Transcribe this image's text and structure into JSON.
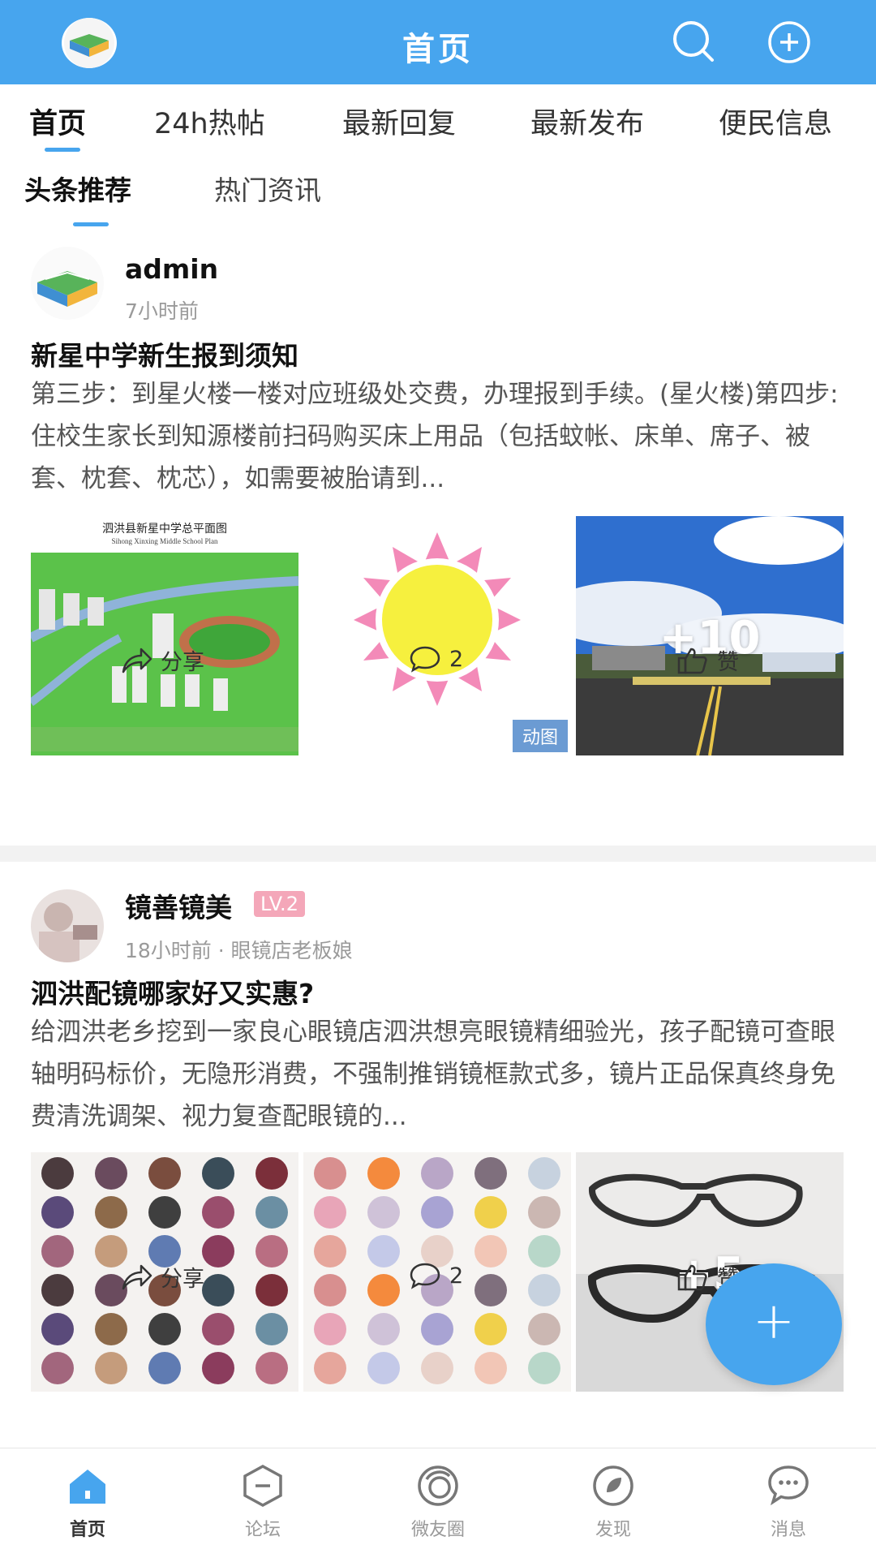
{
  "header": {
    "title": "首页"
  },
  "tabs": [
    {
      "label": "首页",
      "active": true
    },
    {
      "label": "24h热帖"
    },
    {
      "label": "最新回复"
    },
    {
      "label": "最新发布"
    },
    {
      "label": "便民信息"
    }
  ],
  "subtabs": [
    {
      "label": "头条推荐",
      "active": true
    },
    {
      "label": "热门资讯"
    }
  ],
  "posts": [
    {
      "username": "admin",
      "time": "7小时前",
      "title": "新星中学新生报到须知",
      "excerpt": "第三步：到星火楼一楼对应班级处交费，办理报到手续。(星火楼)第四步:住校生家长到知源楼前扫码购买床上用品（包括蚊帐、床单、席子、被套、枕套、枕芯），如需要被胎请到...",
      "images": [
        {
          "caption": "泗洪县新星中学总平面图",
          "caption_en": "Sihong Xinxing Middle School Plan"
        },
        {
          "badge": "动图"
        },
        {
          "more": "+10"
        }
      ],
      "share_label": "分享",
      "comment_count": "2",
      "like_label": "赞"
    },
    {
      "username": "镜善镜美",
      "level": "LV.2",
      "time": "18小时前 · 眼镜店老板娘",
      "title": "泗洪配镜哪家好又实惠?",
      "excerpt": "给泗洪老乡挖到一家良心眼镜店泗洪想亮眼镜精细验光，孩子配镜可查眼轴明码标价，无隐形消费，不强制推销镜框款式多，镜片正品保真终身免费清洗调架、视力复查配眼镜的...",
      "images": [
        {},
        {},
        {
          "more": "+5"
        }
      ],
      "share_label": "分享",
      "comment_count": "2",
      "like_label": "赞"
    }
  ],
  "bottom_nav": [
    {
      "label": "首页",
      "active": true
    },
    {
      "label": "论坛"
    },
    {
      "label": "微友圈"
    },
    {
      "label": "发现"
    },
    {
      "label": "消息"
    }
  ],
  "fab": {
    "label": "+"
  },
  "colors": {
    "accent": "#47a5ee",
    "badge_pink": "#f4a7b9",
    "gif_badge": "#6b9bd3"
  }
}
